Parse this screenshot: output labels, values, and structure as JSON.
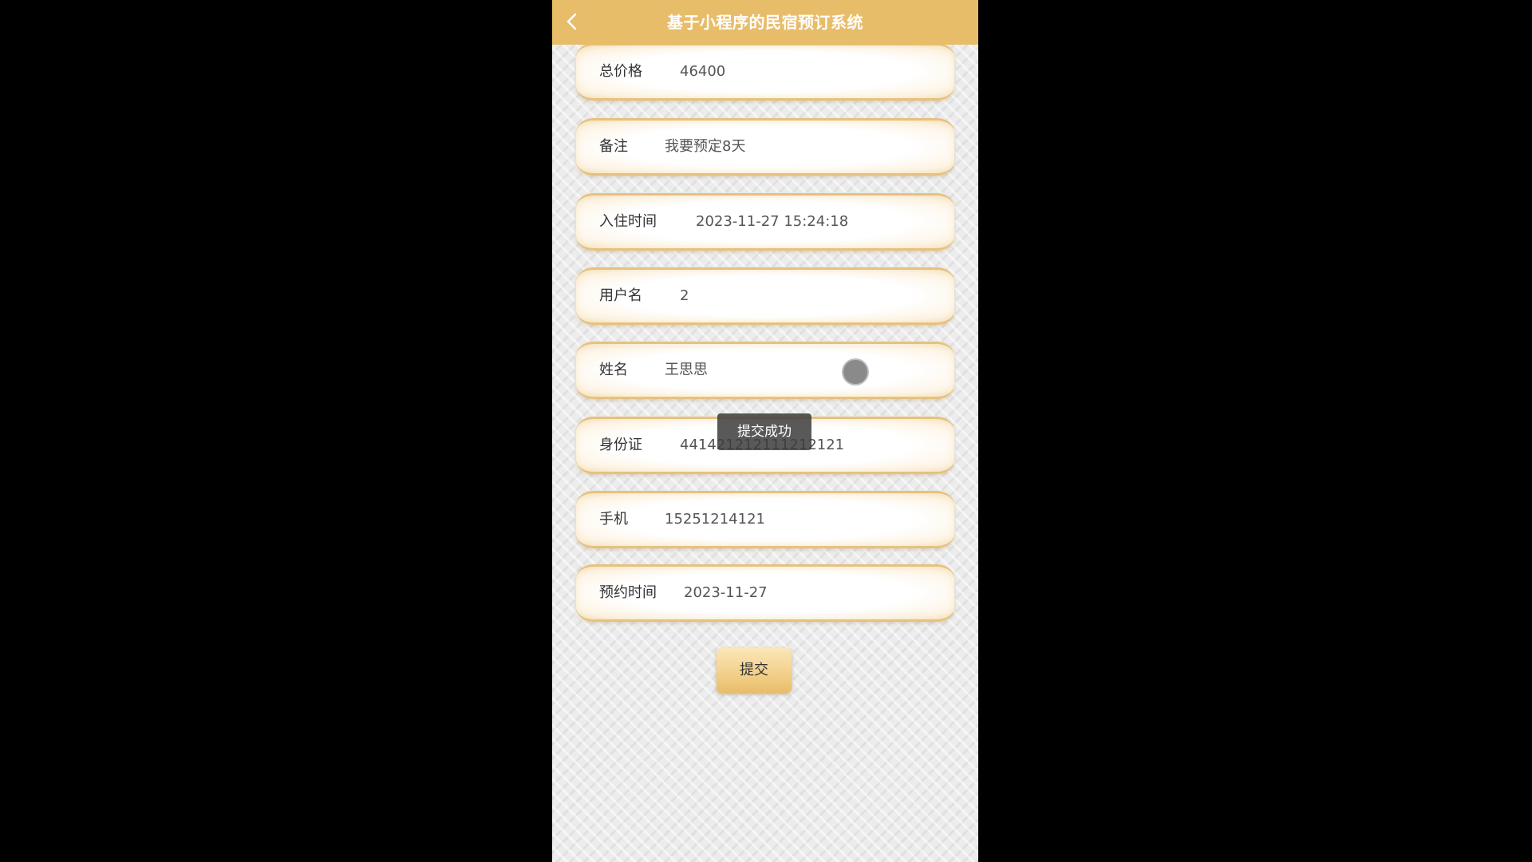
{
  "header": {
    "title": "基于小程序的民宿预订系统",
    "back_icon": "chevron-left-icon"
  },
  "form": {
    "fields": [
      {
        "label": "总价格",
        "value": "46400"
      },
      {
        "label": "备注",
        "value": "我要预定8天"
      },
      {
        "label": "入住时间",
        "value": "2023-11-27 15:24:18"
      },
      {
        "label": "用户名",
        "value": "2"
      },
      {
        "label": "姓名",
        "value": "王思思"
      },
      {
        "label": "身份证",
        "value": "441421212111212121"
      },
      {
        "label": "手机",
        "value": "15251214121"
      },
      {
        "label": "预约时间",
        "value": "2023-11-27"
      }
    ],
    "submit_label": "提交"
  },
  "toast": {
    "message": "提交成功"
  },
  "colors": {
    "accent": "#e8bd6a",
    "field_border": "#e6c17f",
    "background": "#ececec"
  }
}
